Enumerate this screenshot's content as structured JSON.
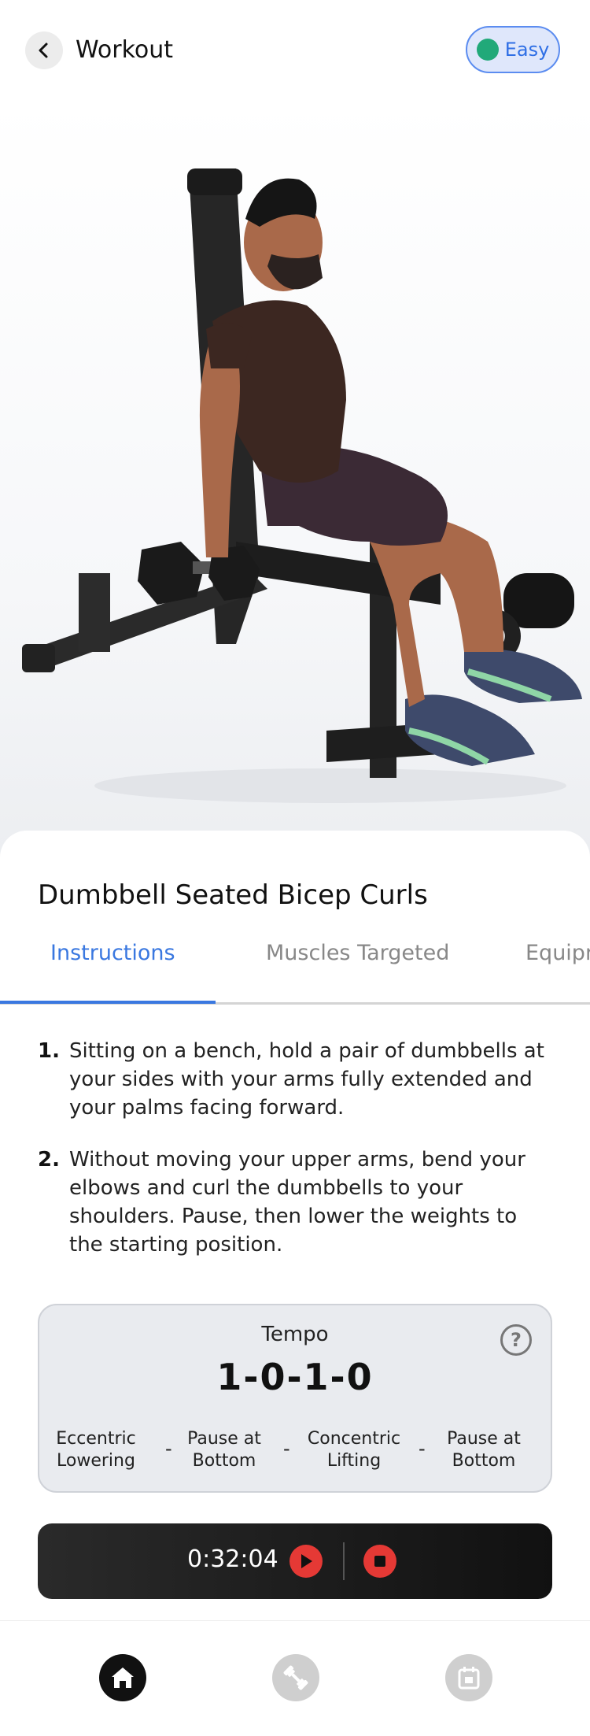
{
  "header": {
    "title": "Workout",
    "difficulty": "Easy",
    "difficulty_color": "#21a979"
  },
  "exercise": {
    "name": "Dumbbell Seated Bicep Curls"
  },
  "tabs": [
    {
      "label": "Instructions",
      "active": true
    },
    {
      "label": "Muscles Targeted",
      "active": false
    },
    {
      "label": "Equipr",
      "active": false
    }
  ],
  "instructions": [
    {
      "num": "1.",
      "text": "Sitting on a bench, hold a pair of dumbbells at your sides with your arms fully extended and your palms facing forward."
    },
    {
      "num": "2.",
      "text": "Without moving your upper arms, bend your elbows and curl the dumbbells to your shoulders. Pause, then lower the weights to the starting position."
    }
  ],
  "tempo": {
    "title": "Tempo",
    "value": "1-0-1-0",
    "help_icon": "?",
    "phases": [
      {
        "line1": "Eccentric",
        "line2": "Lowering"
      },
      {
        "line1": "Pause at",
        "line2": "Bottom"
      },
      {
        "line1": "Concentric",
        "line2": "Lifting"
      },
      {
        "line1": "Pause at",
        "line2": "Bottom"
      }
    ],
    "separator": "-"
  },
  "timer": {
    "time": "0:32:04"
  },
  "nav": [
    {
      "icon": "home-icon",
      "active": true
    },
    {
      "icon": "dumbbell-icon",
      "active": false
    },
    {
      "icon": "calendar-icon",
      "active": false
    }
  ],
  "colors": {
    "accent": "#3a78e0",
    "timer_button": "#e53935"
  }
}
